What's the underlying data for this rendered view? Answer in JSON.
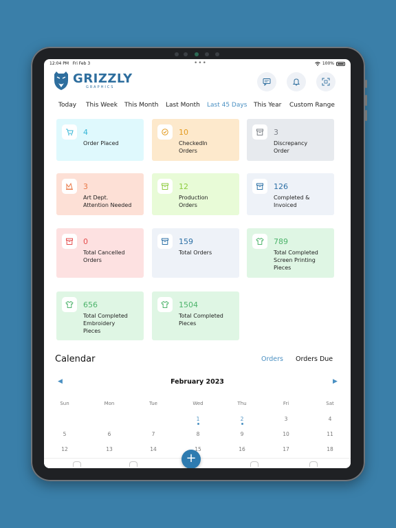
{
  "status": {
    "time": "12:04 PM",
    "date": "Fri Feb 3",
    "dots": "•••",
    "battery": "100%"
  },
  "brand": {
    "name": "GRIZZLY",
    "sub": "GRAPHICS"
  },
  "header_icons": [
    "chat-icon",
    "bell-icon",
    "scan-icon"
  ],
  "filters": [
    "Today",
    "This Week",
    "This Month",
    "Last Month",
    "Last 45 Days",
    "This Year",
    "Custom Range"
  ],
  "active_filter": "Last 45 Days",
  "cards": [
    {
      "value": "4",
      "label": "Order Placed",
      "bg": "#dff9fd",
      "color": "#33b5d6",
      "icon": "cart-icon"
    },
    {
      "value": "10",
      "label": "CheckedIn\nOrders",
      "bg": "#fde9cc",
      "color": "#e39a1f",
      "icon": "checkin-icon"
    },
    {
      "value": "3",
      "label": "Discrepancy\nOrder",
      "bg": "#e7eaee",
      "color": "#7a7f86",
      "icon": "box-icon"
    },
    {
      "value": "3",
      "label": "Art  Dept.\nAttention Needed",
      "bg": "#fde0d6",
      "color": "#e97745",
      "icon": "art-icon"
    },
    {
      "value": "12",
      "label": "Production\nOrders",
      "bg": "#e8fbd7",
      "color": "#8ccb3d",
      "icon": "box-icon"
    },
    {
      "value": "126",
      "label": "Completed &\nInvoiced",
      "bg": "#eef2f8",
      "color": "#2b6fa5",
      "icon": "box-icon"
    },
    {
      "value": "0",
      "label": "Total Cancelled\nOrders",
      "bg": "#fde1e1",
      "color": "#e44b4b",
      "icon": "box-icon"
    },
    {
      "value": "159",
      "label": "Total Orders",
      "bg": "#eef2f8",
      "color": "#2b6fa5",
      "icon": "box-icon"
    },
    {
      "value": "789",
      "label": "Total Completed\nScreen Printing\nPieces",
      "bg": "#dff6e4",
      "color": "#4cb36a",
      "icon": "shirt-icon"
    },
    {
      "value": "656",
      "label": "Total Completed\nEmbroidery\nPieces",
      "bg": "#dff6e4",
      "color": "#4cb36a",
      "icon": "shirt-icon"
    },
    {
      "value": "1504",
      "label": "Total Completed\nPieces",
      "bg": "#dff6e4",
      "color": "#4cb36a",
      "icon": "shirt-icon"
    }
  ],
  "calendar": {
    "title": "Calendar",
    "tabs": [
      "Orders",
      "Orders Due"
    ],
    "active_tab": "Orders",
    "month": "February 2023",
    "weekdays": [
      "Sun",
      "Mon",
      "Tue",
      "Wed",
      "Thu",
      "Fri",
      "Sat"
    ],
    "rows": [
      [
        "",
        "",
        "",
        "1",
        "2",
        "3",
        "4"
      ],
      [
        "5",
        "6",
        "7",
        "8",
        "9",
        "10",
        "11"
      ],
      [
        "12",
        "13",
        "14",
        "15",
        "16",
        "17",
        "18"
      ]
    ],
    "dots": [
      "1",
      "2"
    ]
  },
  "fab_label": "+",
  "colors": {
    "accent": "#4a90c2",
    "primary": "#2e7bb0",
    "background": "#3a7fa9"
  }
}
